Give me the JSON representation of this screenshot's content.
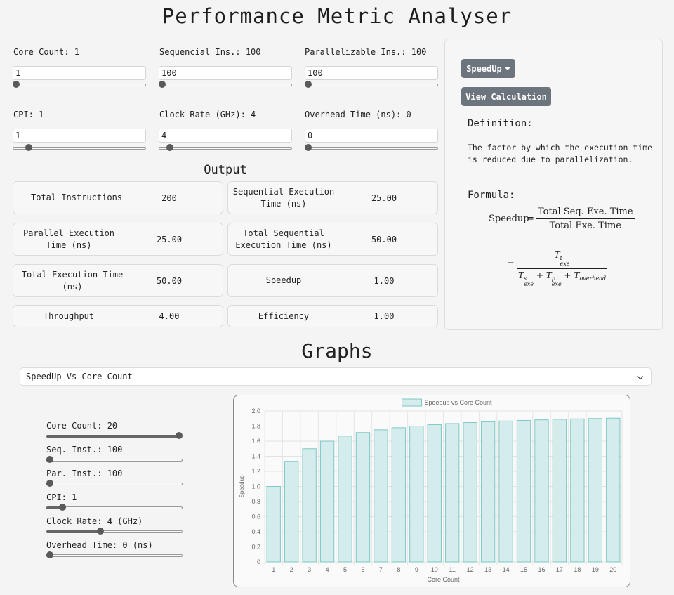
{
  "title": "Performance Metric Analyser",
  "inputs": {
    "core_count": {
      "label": "Core Count: 1",
      "value": "1",
      "slider": 0.0
    },
    "sequential_ins": {
      "label": "Sequencial Ins.: 100",
      "value": "100",
      "slider": 0.0
    },
    "parallelizable_ins": {
      "label": "Parallelizable Ins.: 100",
      "value": "100",
      "slider": 0.0
    },
    "cpi": {
      "label": "CPI: 1",
      "value": "1",
      "slider": 0.1
    },
    "clock_rate": {
      "label": "Clock Rate (GHz): 4",
      "value": "4",
      "slider": 0.06
    },
    "overhead_time": {
      "label": "Overhead Time (ns): 0",
      "value": "0",
      "slider": 0.0
    }
  },
  "output": {
    "heading": "Output",
    "metrics": [
      {
        "label": "Total Instructions",
        "value": "200"
      },
      {
        "label": "Sequential Execution\nTime (ns)",
        "value": "25.00"
      },
      {
        "label": "Parallel Execution\nTime (ns)",
        "value": "25.00"
      },
      {
        "label": "Total Sequential\nExecution Time (ns)",
        "value": "50.00"
      },
      {
        "label": "Total Execution Time\n(ns)",
        "value": "50.00"
      },
      {
        "label": "Speedup",
        "value": "1.00"
      },
      {
        "label": "Throughput",
        "value": "4.00"
      },
      {
        "label": "Efficiency",
        "value": "1.00"
      }
    ]
  },
  "side_panel": {
    "dropdown_label": "SpeedUp",
    "view_button": "View Calculation",
    "definition_title": "Definition:",
    "definition_text": "The factor by which the execution time is reduced due to parallelization.",
    "formula_title": "Formula:",
    "formula": {
      "lhs": "Speedup",
      "eq": "=",
      "numerator": "Total Seq. Exe. Time",
      "denominator": "Total Exe. Time",
      "eq2": "=",
      "num2_base": "T",
      "num2_sup": "t",
      "num2_sub": "exe",
      "den2_t1": "T",
      "den2_t1_sup": "s",
      "den2_t1_sub": "exe",
      "plus1": "+",
      "den2_t2": "T",
      "den2_t2_sup": "p",
      "den2_t2_sub": "exe",
      "plus2": "+",
      "den2_t3": "T",
      "den2_t3_sub": "overhead"
    }
  },
  "graphs": {
    "heading": "Graphs",
    "selected": "SpeedUp Vs Core Count",
    "sliders": [
      {
        "label": "Core Count: 20",
        "fraction": 1.0
      },
      {
        "label": "Seq. Inst.: 100",
        "fraction": 0.0
      },
      {
        "label": "Par. Inst.: 100",
        "fraction": 0.0
      },
      {
        "label": "CPI: 1",
        "fraction": 0.1
      },
      {
        "label": "Clock Rate: 4 (GHz)",
        "fraction": 0.39
      },
      {
        "label": "Overhead Time: 0 (ns)",
        "fraction": 0.0
      }
    ]
  },
  "chart_data": {
    "type": "bar",
    "legend": "Speedup vs Core Count",
    "xlabel": "Core Count",
    "ylabel": "Speedup",
    "ylim": [
      0,
      2.0
    ],
    "yticks": [
      "0",
      "0.2",
      "0.4",
      "0.6",
      "0.8",
      "1.0",
      "1.2",
      "1.4",
      "1.6",
      "1.8",
      "2.0"
    ],
    "categories": [
      "1",
      "2",
      "3",
      "4",
      "5",
      "6",
      "7",
      "8",
      "9",
      "10",
      "11",
      "12",
      "13",
      "14",
      "15",
      "16",
      "17",
      "18",
      "19",
      "20"
    ],
    "values": [
      1.0,
      1.333,
      1.5,
      1.6,
      1.667,
      1.714,
      1.75,
      1.778,
      1.8,
      1.818,
      1.833,
      1.846,
      1.857,
      1.867,
      1.875,
      1.882,
      1.889,
      1.895,
      1.9,
      1.905
    ],
    "grid": true,
    "legend_position": "top",
    "colors": {
      "bar_fill": "#d4eceb",
      "bar_stroke": "#7ec9c6"
    }
  }
}
